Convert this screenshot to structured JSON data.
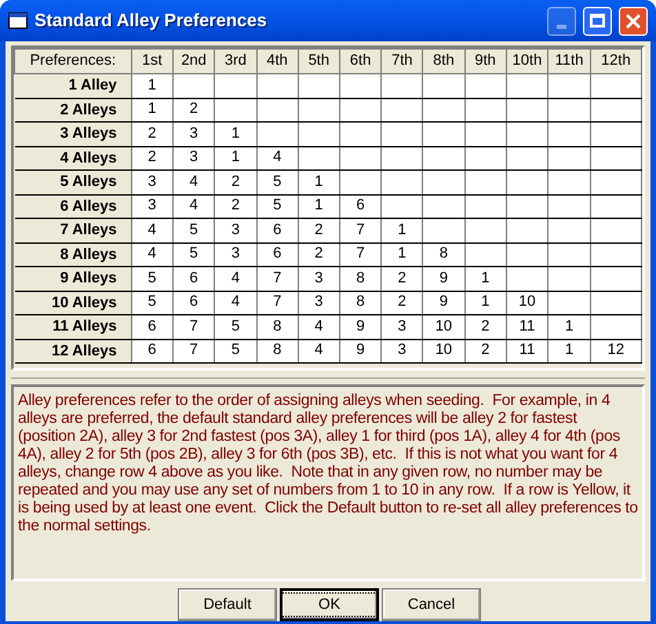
{
  "window": {
    "title": "Standard Alley Preferences"
  },
  "table": {
    "corner": "Preferences:",
    "columns": [
      "1st",
      "2nd",
      "3rd",
      "4th",
      "5th",
      "6th",
      "7th",
      "8th",
      "9th",
      "10th",
      "11th",
      "12th"
    ],
    "rows": [
      {
        "label": "1 Alley",
        "cells": [
          "1"
        ]
      },
      {
        "label": "2 Alleys",
        "cells": [
          "1",
          "2"
        ]
      },
      {
        "label": "3 Alleys",
        "cells": [
          "2",
          "3",
          "1"
        ]
      },
      {
        "label": "4 Alleys",
        "cells": [
          "2",
          "3",
          "1",
          "4"
        ]
      },
      {
        "label": "5 Alleys",
        "cells": [
          "3",
          "4",
          "2",
          "5",
          "1"
        ]
      },
      {
        "label": "6 Alleys",
        "cells": [
          "3",
          "4",
          "2",
          "5",
          "1",
          "6"
        ]
      },
      {
        "label": "7 Alleys",
        "cells": [
          "4",
          "5",
          "3",
          "6",
          "2",
          "7",
          "1"
        ]
      },
      {
        "label": "8 Alleys",
        "cells": [
          "4",
          "5",
          "3",
          "6",
          "2",
          "7",
          "1",
          "8"
        ]
      },
      {
        "label": "9 Alleys",
        "cells": [
          "5",
          "6",
          "4",
          "7",
          "3",
          "8",
          "2",
          "9",
          "1"
        ]
      },
      {
        "label": "10 Alleys",
        "cells": [
          "5",
          "6",
          "4",
          "7",
          "3",
          "8",
          "2",
          "9",
          "1",
          "10"
        ]
      },
      {
        "label": "11 Alleys",
        "cells": [
          "6",
          "7",
          "5",
          "8",
          "4",
          "9",
          "3",
          "10",
          "2",
          "11",
          "1"
        ]
      },
      {
        "label": "12 Alleys",
        "cells": [
          "6",
          "7",
          "5",
          "8",
          "4",
          "9",
          "3",
          "10",
          "2",
          "11",
          "1",
          "12"
        ]
      }
    ]
  },
  "note": "Alley preferences refer to the order of assigning alleys when seeding.  For example, in 4 alleys are preferred, the default standard alley preferences will be alley 2 for fastest (position 2A), alley 3 for 2nd fastest (pos 3A), alley 1 for third (pos 1A), alley 4 for 4th (pos 4A), alley 2 for 5th (pos 2B), alley 3 for 6th (pos 3B), etc.  If this is not what you want for 4 alleys, change row 4 above as you like.  Note that in any given row, no number may be repeated and you may use any set of numbers from 1 to 10 in any row.  If a row is Yellow, it is being used by at least one event.  Click the Default button to re-set all alley preferences to the normal settings.",
  "buttons": [
    {
      "label": "Default",
      "default": false
    },
    {
      "label": "OK",
      "default": true
    },
    {
      "label": "Cancel",
      "default": false
    }
  ]
}
